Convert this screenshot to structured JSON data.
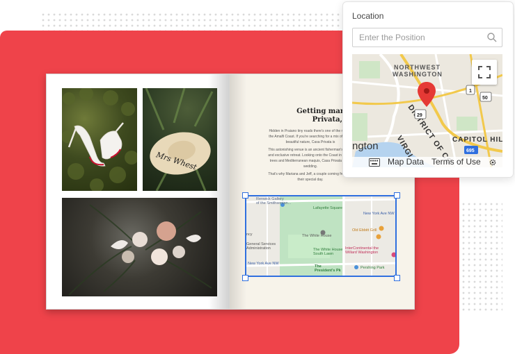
{
  "colors": {
    "accent_red": "#ef434a",
    "selection_blue": "#2f6fdf",
    "page_cream": "#f7f3ea"
  },
  "article": {
    "title": "Getting married in Pra\nPrivata, Amalfi",
    "paragraphs": [
      "Hidden in Praiano tiny roads there's one of the most e\nthe Amalfi Coast. If you're searching for a mix of elega\nbeautiful nature, Casa Privata is",
      "This astonishing venue is an ancient fisherman's ruin a\nand exclusive retreat. Looking onto the Coast in a winn\ntrees and Mediterranean maquis, Casa Privata is the\nwedding.",
      "That's why Mariana and Jeff, a couple coming from the\ntheir special day."
    ]
  },
  "photos": {
    "hat_text": "Mrs Whest"
  },
  "embedded_map": {
    "labels": [
      "Renwick Gallery\nof the Smithsonian...",
      "Lafayette Square",
      "New York Ave NW",
      "ncy",
      "Old Ebbitt Grill",
      "The White House",
      "General Services\nAdministration",
      "The White House\nSouth Lawn",
      "InterContinental the\nWillard Washington",
      "New York Ave NW",
      "The\nPresident's Pk",
      "Pershing Park"
    ]
  },
  "location_panel": {
    "title": "Location",
    "search_placeholder": "Enter the Position",
    "search_value": "",
    "map_labels": {
      "northwest": "NORTHWEST",
      "washington": "WASHINGTON",
      "district": "DISTRICT OF CO",
      "virginia": "VIRGI",
      "capitol_hill": "CAPITOL HILL",
      "partial_city": "ngton",
      "route_29": "29",
      "route_50": "50",
      "route_1": "1",
      "route_695": "695"
    },
    "footer": {
      "map_data": "Map Data",
      "terms": "Terms of Use"
    },
    "icons": [
      "search-icon",
      "fullscreen-icon",
      "map-pin-icon",
      "keyboard-icon",
      "settings-icon"
    ]
  }
}
